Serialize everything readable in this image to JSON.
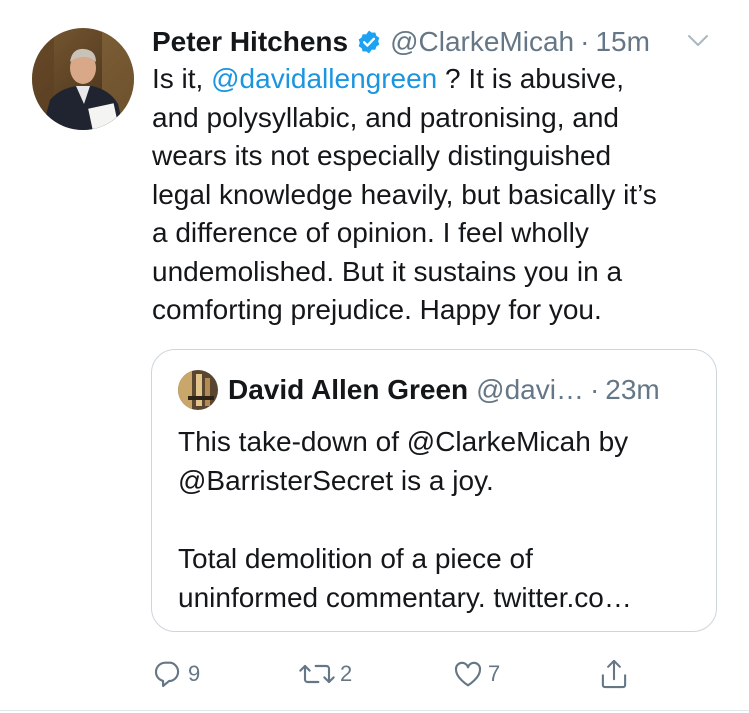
{
  "tweet": {
    "author_name": "Peter Hitchens",
    "handle": "@ClarkeMicah",
    "separator": "·",
    "time": "15m",
    "body": {
      "line1_pre": "Is it, ",
      "line1_mention": "@davidallengreen",
      "line1_post": " ? It is abusive,",
      "line2": "and polysyllabic, and patronising, and",
      "line3": "wears its not especially distinguished",
      "line4": "legal knowledge heavily, but basically it’s",
      "line5": "a difference of opinion. I feel wholly",
      "line6": "undemolished. But it sustains you in a",
      "line7": "comforting prejudice. Happy for you."
    }
  },
  "quoted": {
    "author_name": "David Allen Green",
    "handle": "@davi…",
    "separator": "·",
    "time": "23m",
    "line1": "This take-down of @ClarkeMicah by",
    "line2": "@BarristerSecret is a joy.",
    "line3": "Total demolition of a piece of",
    "line4": "uninformed commentary. twitter.co…"
  },
  "actions": {
    "reply_count": "9",
    "retweet_count": "2",
    "like_count": "7"
  },
  "icons": {
    "verified": "verified-badge-icon",
    "more": "chevron-down-icon",
    "reply": "reply-icon",
    "retweet": "retweet-icon",
    "like": "heart-icon",
    "share": "share-icon"
  },
  "colors": {
    "link": "#1b95e0",
    "verified": "#1da1f2",
    "secondary_text": "#657786",
    "primary_text": "#14171a",
    "border": "#ccd6dd"
  }
}
